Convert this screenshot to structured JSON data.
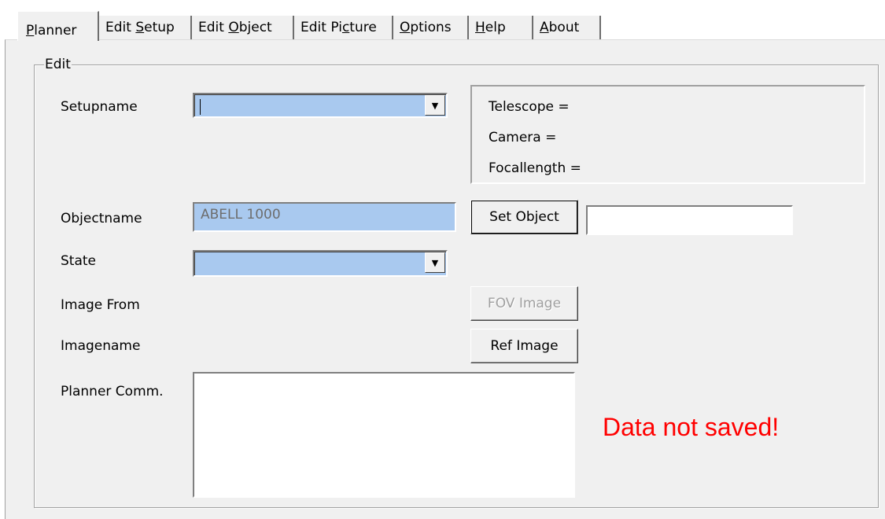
{
  "tabs": [
    {
      "label": "Planner",
      "active": true
    },
    {
      "label": "Edit Setup"
    },
    {
      "label": "Edit Object"
    },
    {
      "label": "Edit Picture"
    },
    {
      "label": "Options"
    },
    {
      "label": "Help"
    },
    {
      "label": "About"
    }
  ],
  "group": {
    "title": "Edit"
  },
  "form": {
    "setupname_label": "Setupname",
    "setupname_value": "",
    "objectname_label": "Objectname",
    "objectname_value": "ABELL 1000",
    "state_label": "State",
    "state_value": "",
    "image_from_label": "Image From",
    "imagename_label": "Imagename",
    "planner_comm_label": "Planner Comm.",
    "planner_comm_value": "",
    "object_extra_value": ""
  },
  "setup_info": {
    "telescope": "Telescope =",
    "camera": "Camera =",
    "focallength": "Focallength ="
  },
  "buttons": {
    "set_object": "Set Object",
    "fov_image": "FOV Image",
    "ref_image": "Ref Image"
  },
  "status": {
    "message": "Data not saved!",
    "color": "#ff0000"
  },
  "icons": {
    "dropdown": "chevron-down-icon"
  }
}
